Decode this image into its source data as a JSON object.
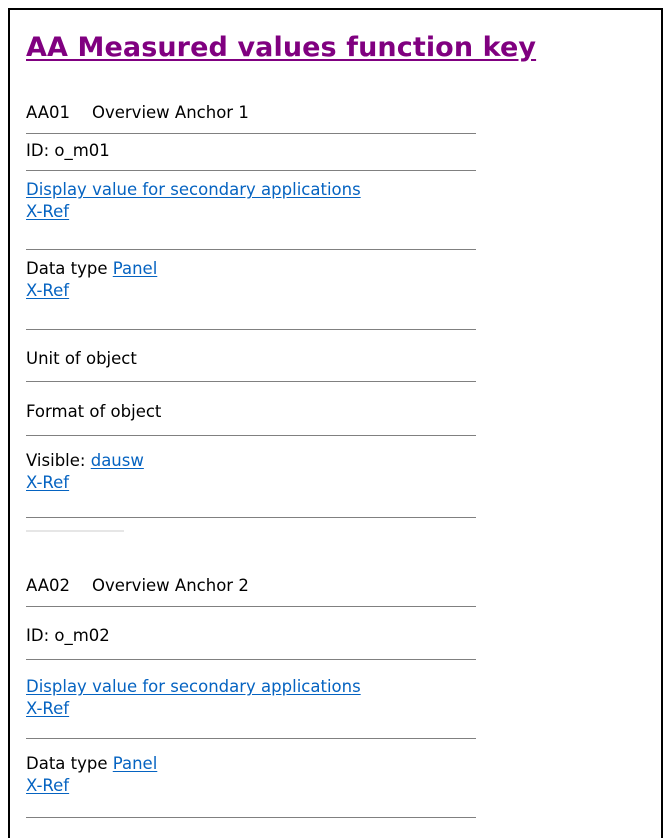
{
  "title": "AA Measured values function key",
  "entries": [
    {
      "code": "AA01",
      "name": "Overview Anchor 1",
      "id_label": "ID: o_m01",
      "display_link": "Display value for secondary applications",
      "display_xref": "X-Ref",
      "datatype_label": "Data type",
      "datatype_link": "Panel",
      "datatype_xref": "X-Ref",
      "unit_label": "Unit of object",
      "format_label": "Format of object",
      "visible_label": "Visible:",
      "visible_link": "dausw",
      "visible_xref": "X-Ref"
    },
    {
      "code": "AA02",
      "name": "Overview Anchor 2",
      "id_label": "ID: o_m02",
      "display_link": "Display value for secondary applications",
      "display_xref": "X-Ref",
      "datatype_label": "Data type",
      "datatype_link": "Panel",
      "datatype_xref": "X-Ref"
    }
  ],
  "colors": {
    "title": "#800080",
    "link": "#0563C1",
    "divider": "#808080"
  }
}
